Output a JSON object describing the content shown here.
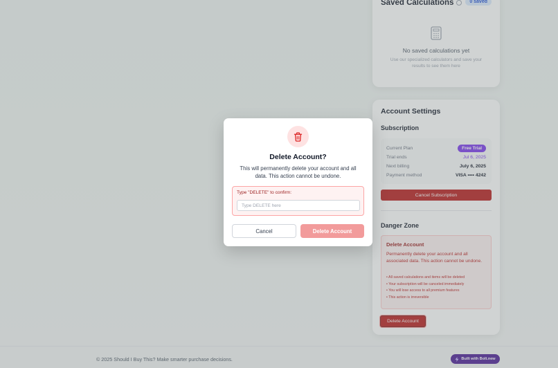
{
  "saved": {
    "title": "Saved Calculations",
    "badge": "0 saved",
    "empty_title": "No saved calculations yet",
    "empty_sub": "Use our specialized calculators and save your results to see them here"
  },
  "settings": {
    "title": "Account Settings",
    "subscription_heading": "Subscription",
    "plan_rows": [
      {
        "label": "Current Plan",
        "value": "Free Trial"
      },
      {
        "label": "Trial ends",
        "value": "Jul 6, 2025"
      },
      {
        "label": "Next billing",
        "value": "July 6, 2025"
      },
      {
        "label": "Payment method",
        "value": "VISA •••• 4242"
      }
    ],
    "cancel_sub_label": "Cancel Subscription",
    "danger_heading": "Danger Zone",
    "danger_title": "Delete Account",
    "danger_text": "Permanently delete your account and all associated data. This action cannot be undone.",
    "danger_items": [
      "• All saved calculations and items will be deleted",
      "• Your subscription will be canceled immediately",
      "• You will lose access to all premium features",
      "• This action is irreversible"
    ],
    "danger_button": "Delete Account"
  },
  "footer": {
    "text": "© 2025 Should I Buy This? Make smarter purchase decisions.",
    "bolt_label": "Built with Bolt.new"
  },
  "modal": {
    "title": "Delete Account?",
    "description": "This will permanently delete your account and all data. This action cannot be undone.",
    "confirm_label": "Type \"DELETE\" to confirm:",
    "confirm_placeholder": "Type DELETE here",
    "confirm_value": "",
    "cancel_label": "Cancel",
    "delete_label": "Delete Account"
  },
  "colors": {
    "danger": "#b91c1c",
    "danger_light": "#fef2f2",
    "accent_purple": "#7c3aed",
    "disabled_delete": "#f29b9b"
  },
  "icons": {
    "modal": "trash-icon",
    "empty_state": "calculator-icon",
    "info": "info-icon",
    "bolt": "bolt-icon"
  }
}
